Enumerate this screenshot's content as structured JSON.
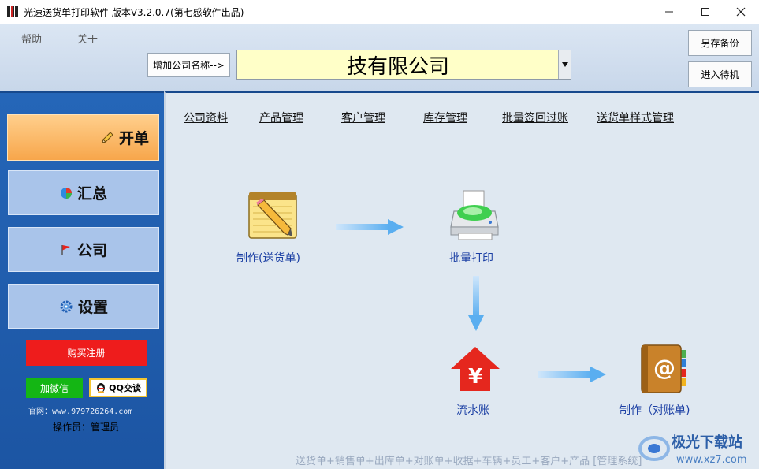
{
  "window": {
    "title": "光速送货单打印软件 版本V3.2.0.7(第七感软件出品)"
  },
  "menu": {
    "help": "帮助",
    "about": "关于"
  },
  "header": {
    "add_company_label": "增加公司名称-->",
    "company_name": "技有限公司",
    "save_backup_label": "另存备份",
    "standby_label": "进入待机"
  },
  "sidebar": {
    "items": [
      {
        "label": "开单",
        "icon": "pencil-icon"
      },
      {
        "label": "汇总",
        "icon": "pie-chart-icon"
      },
      {
        "label": "公司",
        "icon": "flag-icon"
      },
      {
        "label": "设置",
        "icon": "gear-icon"
      }
    ],
    "buy_label": "购买注册",
    "wechat_label": "加微信",
    "qq_label": "QQ交谈",
    "website": "官网：www.979726264.com",
    "operator": "操作员：管理员"
  },
  "tabs": [
    {
      "label": "公司资料"
    },
    {
      "label": "产品管理"
    },
    {
      "label": "客户管理"
    },
    {
      "label": "库存管理"
    },
    {
      "label": "批量签回过账"
    },
    {
      "label": "送货单样式管理"
    }
  ],
  "flow": {
    "make_delivery": "制作(送货单)",
    "batch_print": "批量打印",
    "ledger": "流水账",
    "make_statement": "制作（对账单)"
  },
  "footer": {
    "text": "送货单+销售单+出库单+对账单+收据+车辆+员工+客户+产品 [管理系统]"
  },
  "watermark": {
    "name": "极光下载站",
    "url": "www.xz7.com"
  },
  "colors": {
    "sidebar_bg": "#2566b8",
    "active_nav": "#f7a64b",
    "nav_bg": "#a9c4ea",
    "buy_button": "#ee1c1c",
    "wechat_button": "#14b614",
    "company_field": "#ffffc8",
    "flow_label": "#1b3fa4"
  }
}
